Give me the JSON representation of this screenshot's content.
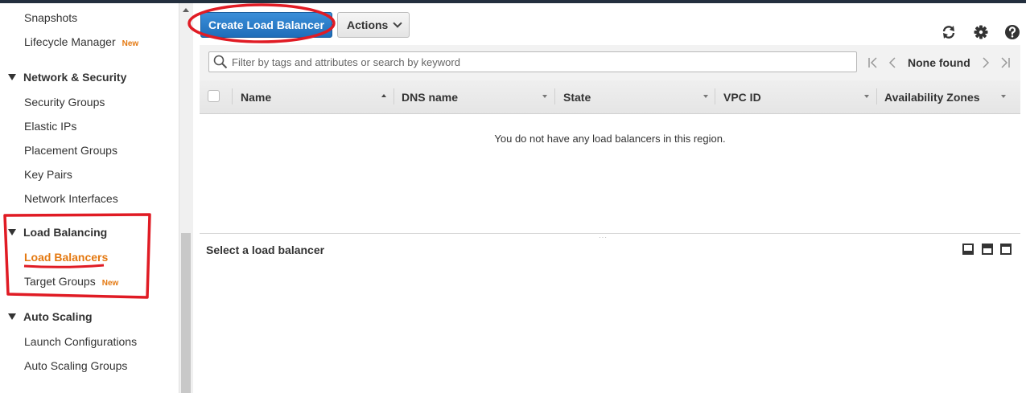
{
  "sidebar": {
    "items_top": [
      {
        "label": "Snapshots",
        "badge": ""
      },
      {
        "label": "Lifecycle Manager",
        "badge": "New"
      }
    ],
    "network_security": {
      "title": "Network & Security",
      "items": [
        "Security Groups",
        "Elastic IPs",
        "Placement Groups",
        "Key Pairs",
        "Network Interfaces"
      ]
    },
    "load_balancing": {
      "title": "Load Balancing",
      "items": [
        {
          "label": "Load Balancers",
          "badge": "",
          "active": true
        },
        {
          "label": "Target Groups",
          "badge": "New",
          "active": false
        }
      ]
    },
    "auto_scaling": {
      "title": "Auto Scaling",
      "items": [
        "Launch Configurations",
        "Auto Scaling Groups"
      ]
    }
  },
  "toolbar": {
    "create_label": "Create Load Balancer",
    "actions_label": "Actions"
  },
  "search": {
    "placeholder": "Filter by tags and attributes or search by keyword"
  },
  "pager": {
    "status": "None found"
  },
  "table": {
    "columns": [
      "Name",
      "DNS name",
      "State",
      "VPC ID",
      "Availability Zones"
    ],
    "empty_message": "You do not have any load balancers in this region."
  },
  "details": {
    "title": "Select a load balancer"
  },
  "colors": {
    "primary": "#1f6db9",
    "accent_orange": "#e47911",
    "annotation_red": "#e01b24"
  }
}
